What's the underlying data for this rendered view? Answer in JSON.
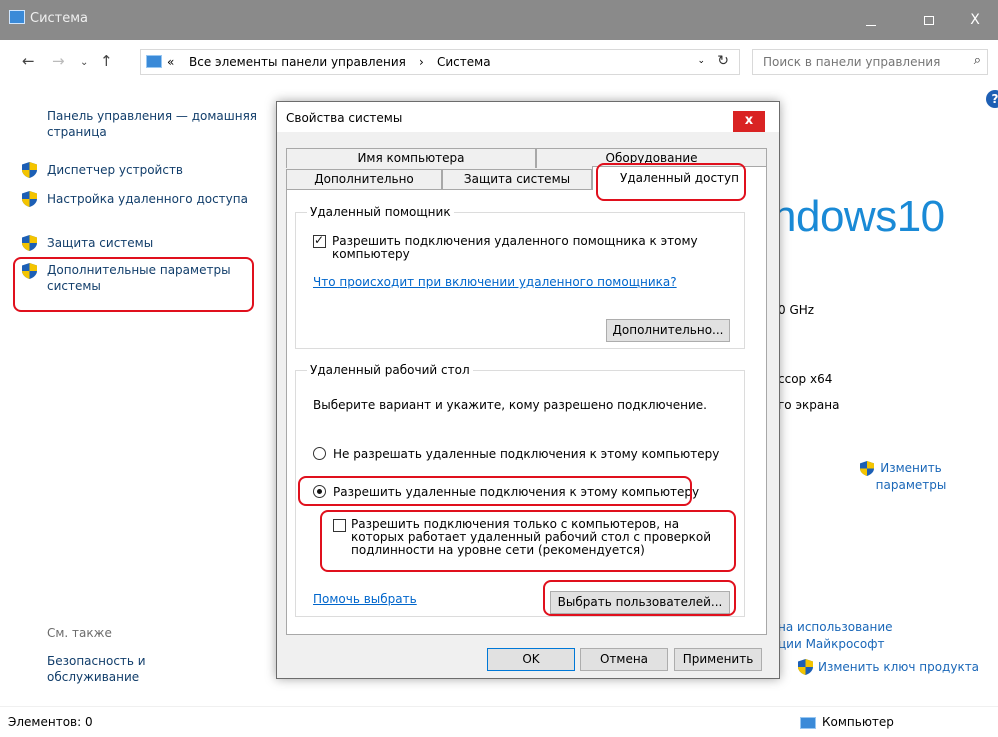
{
  "window": {
    "title": "Система",
    "minimize": "—",
    "maximize": "",
    "close": "X"
  },
  "nav": {
    "back": "←",
    "forward": "→",
    "recent": "⌄",
    "up": "↑",
    "breadcrumb_prefix": "«",
    "breadcrumb_all": "Все элементы панели управления",
    "breadcrumb_arrow": "›",
    "breadcrumb_current": "Система",
    "dropdown": "⌄",
    "refresh": "↻",
    "search_placeholder": "Поиск в панели управления",
    "search_icon": "⌕"
  },
  "left": {
    "home": "Панель управления — домашняя страница",
    "links": [
      "Диспетчер устройств",
      "Настройка удаленного доступа",
      "Защита системы",
      "Дополнительные параметры системы"
    ],
    "see_also": "См. также",
    "security": "Безопасность и обслуживание"
  },
  "right": {
    "help": "?",
    "windows_brand": "ndows10",
    "cpu_speed": "0 GHz",
    "proc": "ссор x64",
    "screen": "го экрана",
    "change_params": "Изменить параметры",
    "license_line1": "на использование",
    "license_line2": "ции Майкрософт",
    "change_key": "Изменить ключ продукта"
  },
  "status": {
    "items": "Элементов: 0",
    "computer": "Компьютер"
  },
  "dialog": {
    "title": "Свойства системы",
    "close": "x",
    "tabs": {
      "computer_name": "Имя компьютера",
      "hardware": "Оборудование",
      "advanced": "Дополнительно",
      "protection": "Защита системы",
      "remote": "Удаленный доступ"
    },
    "assistant": {
      "legend": "Удаленный помощник",
      "allow": "Разрешить подключения удаленного помощника к этому компьютеру",
      "allow_checked": true,
      "link": "Что происходит при включении удаленного помощника?",
      "advanced_button": "Дополнительно..."
    },
    "desktop": {
      "legend": "Удаленный рабочий стол",
      "instruction": "Выберите вариант и укажите, кому разрешено подключение.",
      "deny": "Не разрешать удаленные подключения к этому компьютеру",
      "allow": "Разрешить удаленные подключения к этому компьютеру",
      "selected": "allow",
      "nla": "Разрешить подключения только с компьютеров, на которых работает удаленный рабочий стол с проверкой подлинности на уровне сети (рекомендуется)",
      "nla_checked": false,
      "help_link": "Помочь выбрать",
      "select_users": "Выбрать пользователей..."
    },
    "buttons": {
      "ok": "OK",
      "cancel": "Отмена",
      "apply": "Применить"
    }
  },
  "colors": {
    "accent": "#0078d7",
    "highlight_border": "#e0101d",
    "link": "#0066cc",
    "titlebar": "#8a8a8a",
    "win10_brand": "#1a8ad6"
  }
}
